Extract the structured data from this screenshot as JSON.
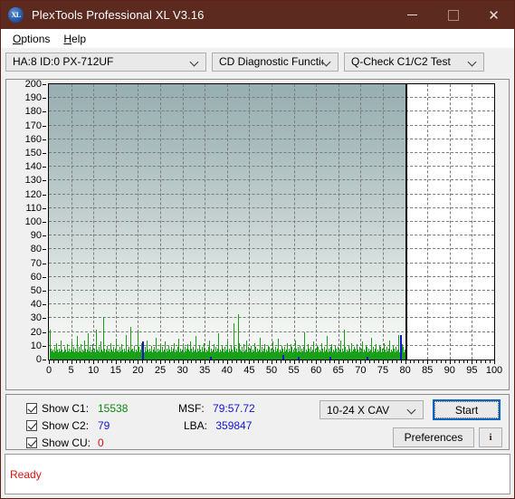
{
  "window": {
    "title": "PlexTools Professional XL V3.16",
    "logo_text": "XL",
    "minimize_label": "Minimize",
    "maximize_label": "Maximize",
    "close_label": "Close"
  },
  "menu": {
    "items": [
      {
        "label": "Options",
        "accel": "O"
      },
      {
        "label": "Help",
        "accel": "H"
      }
    ]
  },
  "toolbar": {
    "drive_combo": "HA:8 ID:0  PX-712UF",
    "function_combo": "CD Diagnostic Functions",
    "test_combo": "Q-Check C1/C2 Test"
  },
  "controls": {
    "show_c1_label": "Show C1:",
    "show_c2_label": "Show C2:",
    "show_cu_label": "Show CU:",
    "show_c1_checked": true,
    "show_c2_checked": true,
    "show_cu_checked": true,
    "c1_value": "15538",
    "c2_value": "79",
    "cu_value": "0",
    "msf_label": "MSF:",
    "msf_value": "79:57.72",
    "lba_label": "LBA:",
    "lba_value": "359847",
    "speed_combo": "10-24 X CAV",
    "start_label": "Start",
    "preferences_label": "Preferences",
    "info_label": "i"
  },
  "status": {
    "text": "Ready"
  },
  "colors": {
    "titlebar": "#5c2a1e",
    "c1": "#19a019",
    "c2": "#1414d2",
    "cu": "#d01010",
    "accent": "#0a64c8",
    "status_text": "#e01010"
  },
  "chart_data": {
    "type": "bar",
    "title": "",
    "xlabel": "",
    "ylabel": "",
    "xlim": [
      0,
      100
    ],
    "ylim": [
      0,
      200
    ],
    "ytick_step": 10,
    "xtick_step": 5,
    "yticks": [
      0,
      10,
      20,
      30,
      40,
      50,
      60,
      70,
      80,
      90,
      100,
      110,
      120,
      130,
      140,
      150,
      160,
      170,
      180,
      190,
      200
    ],
    "xticks": [
      0,
      5,
      10,
      15,
      20,
      25,
      30,
      35,
      40,
      45,
      50,
      55,
      60,
      65,
      70,
      75,
      80,
      85,
      90,
      95,
      100
    ],
    "grid": true,
    "data_end_x": 80,
    "marker_line_x": 80,
    "legend": [
      "C1",
      "C2",
      "CU"
    ],
    "series": [
      {
        "name": "C1",
        "color": "#19a019",
        "x": [
          0.2,
          0.4,
          0.6,
          0.8,
          1.0,
          1.2,
          1.4,
          1.6,
          1.8,
          2.0,
          2.2,
          2.4,
          2.6,
          2.8,
          3.0,
          3.2,
          3.4,
          3.6,
          3.8,
          4.0,
          4.2,
          4.4,
          4.6,
          4.8,
          5.0,
          5.2,
          5.4,
          5.6,
          5.8,
          6.0,
          6.2,
          6.4,
          6.6,
          6.8,
          7.0,
          7.2,
          7.4,
          7.6,
          7.8,
          8.0,
          8.2,
          8.4,
          8.6,
          8.8,
          9.0,
          9.2,
          9.4,
          9.6,
          9.8,
          10.0,
          10.2,
          10.4,
          10.6,
          10.8,
          11.0,
          11.2,
          11.4,
          11.6,
          11.8,
          12.0,
          12.2,
          12.4,
          12.6,
          12.8,
          13.0,
          13.2,
          13.4,
          13.6,
          13.8,
          14.0,
          14.2,
          14.4,
          14.6,
          14.8,
          15.0,
          15.2,
          15.4,
          15.6,
          15.8,
          16.0,
          16.2,
          16.4,
          16.6,
          16.8,
          17.0,
          17.2,
          17.4,
          17.6,
          17.8,
          18.0,
          18.2,
          18.4,
          18.6,
          18.8,
          19.0,
          19.2,
          19.4,
          19.6,
          19.8,
          20.0,
          20.2,
          20.4,
          20.6,
          20.8,
          21.0,
          21.2,
          21.4,
          21.6,
          21.8,
          22.0,
          22.2,
          22.4,
          22.6,
          22.8,
          23.0,
          23.2,
          23.4,
          23.6,
          23.8,
          24.0,
          24.2,
          24.4,
          24.6,
          24.8,
          25.0,
          25.2,
          25.4,
          25.6,
          25.8,
          26.0,
          26.2,
          26.4,
          26.6,
          26.8,
          27.0,
          27.2,
          27.4,
          27.6,
          27.8,
          28.0,
          28.2,
          28.4,
          28.6,
          28.8,
          29.0,
          29.2,
          29.4,
          29.6,
          29.8,
          30.0,
          30.2,
          30.4,
          30.6,
          30.8,
          31.0,
          31.2,
          31.4,
          31.6,
          31.8,
          32.0,
          32.2,
          32.4,
          32.6,
          32.8,
          33.0,
          33.2,
          33.4,
          33.6,
          33.8,
          34.0,
          34.2,
          34.4,
          34.6,
          34.8,
          35.0,
          35.2,
          35.4,
          35.6,
          35.8,
          36.0,
          36.2,
          36.4,
          36.6,
          36.8,
          37.0,
          37.2,
          37.4,
          37.6,
          37.8,
          38.0,
          38.2,
          38.4,
          38.6,
          38.8,
          39.0,
          39.2,
          39.4,
          39.6,
          39.8,
          40.0,
          40.2,
          40.4,
          40.6,
          40.8,
          41.0,
          41.2,
          41.4,
          41.6,
          41.8,
          42.0,
          42.2,
          42.4,
          42.6,
          42.8,
          43.0,
          43.2,
          43.4,
          43.6,
          43.8,
          44.0,
          44.2,
          44.4,
          44.6,
          44.8,
          45.0,
          45.2,
          45.4,
          45.6,
          45.8,
          46.0,
          46.2,
          46.4,
          46.6,
          46.8,
          47.0,
          47.2,
          47.4,
          47.6,
          47.8,
          48.0,
          48.2,
          48.4,
          48.6,
          48.8,
          49.0,
          49.2,
          49.4,
          49.6,
          49.8,
          50.0,
          50.2,
          50.4,
          50.6,
          50.8,
          51.0,
          51.2,
          51.4,
          51.6,
          51.8,
          52.0,
          52.2,
          52.4,
          52.6,
          52.8,
          53.0,
          53.2,
          53.4,
          53.6,
          53.8,
          54.0,
          54.2,
          54.4,
          54.6,
          54.8,
          55.0,
          55.2,
          55.4,
          55.6,
          55.8,
          56.0,
          56.2,
          56.4,
          56.6,
          56.8,
          57.0,
          57.2,
          57.4,
          57.6,
          57.8,
          58.0,
          58.2,
          58.4,
          58.6,
          58.8,
          59.0,
          59.2,
          59.4,
          59.6,
          59.8,
          60.0,
          60.2,
          60.4,
          60.6,
          60.8,
          61.0,
          61.2,
          61.4,
          61.6,
          61.8,
          62.0,
          62.2,
          62.4,
          62.6,
          62.8,
          63.0,
          63.2,
          63.4,
          63.6,
          63.8,
          64.0,
          64.2,
          64.4,
          64.6,
          64.8,
          65.0,
          65.2,
          65.4,
          65.6,
          65.8,
          66.0,
          66.2,
          66.4,
          66.6,
          66.8,
          67.0,
          67.2,
          67.4,
          67.6,
          67.8,
          68.0,
          68.2,
          68.4,
          68.6,
          68.8,
          69.0,
          69.2,
          69.4,
          69.6,
          69.8,
          70.0,
          70.2,
          70.4,
          70.6,
          70.8,
          71.0,
          71.2,
          71.4,
          71.6,
          71.8,
          72.0,
          72.2,
          72.4,
          72.6,
          72.8,
          73.0,
          73.2,
          73.4,
          73.6,
          73.8,
          74.0,
          74.2,
          74.4,
          74.6,
          74.8,
          75.0,
          75.2,
          75.4,
          75.6,
          75.8,
          76.0,
          76.2,
          76.4,
          76.6,
          76.8,
          77.0,
          77.2,
          77.4,
          77.6,
          77.8,
          78.0,
          78.2,
          78.4,
          78.6,
          78.8,
          79.0,
          79.2,
          79.4,
          79.6,
          79.8
        ],
        "values": [
          22,
          8,
          6,
          7,
          5,
          9,
          6,
          12,
          7,
          5,
          8,
          6,
          14,
          7,
          5,
          6,
          9,
          7,
          5,
          11,
          6,
          8,
          5,
          7,
          13,
          6,
          9,
          5,
          8,
          6,
          17,
          7,
          5,
          9,
          6,
          11,
          5,
          7,
          6,
          14,
          8,
          5,
          7,
          19,
          6,
          9,
          5,
          7,
          11,
          6,
          8,
          5,
          22,
          7,
          6,
          9,
          5,
          13,
          7,
          6,
          31,
          8,
          5,
          7,
          10,
          6,
          8,
          5,
          12,
          7,
          6,
          9,
          5,
          8,
          15,
          6,
          7,
          5,
          9,
          6,
          11,
          7,
          5,
          8,
          6,
          18,
          5,
          7,
          9,
          6,
          24,
          7,
          5,
          8,
          6,
          10,
          5,
          7,
          6,
          21,
          9,
          5,
          7,
          12,
          6,
          8,
          5,
          9,
          6,
          14,
          7,
          5,
          8,
          6,
          10,
          5,
          7,
          9,
          6,
          16,
          5,
          8,
          6,
          7,
          11,
          5,
          9,
          6,
          7,
          13,
          5,
          8,
          6,
          10,
          7,
          5,
          9,
          6,
          8,
          12,
          5,
          7,
          6,
          9,
          15,
          5,
          8,
          6,
          7,
          10,
          5,
          9,
          6,
          8,
          11,
          5,
          7,
          6,
          13,
          8,
          5,
          9,
          6,
          7,
          17,
          5,
          8,
          6,
          10,
          7,
          5,
          9,
          6,
          12,
          8,
          5,
          7,
          6,
          9,
          14,
          5,
          8,
          6,
          7,
          11,
          5,
          9,
          6,
          8,
          19,
          5,
          7,
          6,
          10,
          8,
          5,
          9,
          6,
          7,
          13,
          5,
          8,
          6,
          10,
          7,
          5,
          26,
          9,
          6,
          8,
          5,
          33,
          12,
          7,
          6,
          9,
          5,
          11,
          8,
          6,
          7,
          14,
          5,
          9,
          6,
          8,
          10,
          5,
          7,
          6,
          12,
          9,
          5,
          8,
          6,
          7,
          16,
          5,
          9,
          6,
          8,
          11,
          5,
          7,
          6,
          10,
          9,
          5,
          8,
          6,
          13,
          7,
          5,
          9,
          6,
          8,
          15,
          5,
          7,
          6,
          10,
          8,
          5,
          9,
          6,
          7,
          12,
          5,
          8,
          6,
          11,
          9,
          5,
          7,
          6,
          14,
          8,
          5,
          9,
          6,
          7,
          10,
          5,
          8,
          6,
          9,
          20,
          5,
          7,
          6,
          11,
          8,
          5,
          9,
          6,
          7,
          13,
          5,
          8,
          6,
          10,
          9,
          5,
          7,
          6,
          12,
          8,
          5,
          9,
          6,
          7,
          17,
          5,
          8,
          6,
          9,
          11,
          5,
          7,
          6,
          10,
          8,
          5,
          9,
          6,
          7,
          14,
          5,
          8,
          6,
          22,
          9,
          5,
          7,
          6,
          10,
          8,
          5,
          12,
          6,
          7,
          9,
          5,
          8,
          6,
          11,
          7,
          5,
          9,
          6,
          8,
          13,
          5,
          7,
          6,
          10,
          9,
          5,
          8,
          6,
          7,
          16,
          5,
          9,
          6,
          8,
          11,
          5,
          7,
          6,
          10,
          9,
          5,
          8,
          6,
          12,
          7,
          5,
          9,
          6,
          8,
          14,
          5,
          7,
          6,
          10,
          8,
          5,
          9,
          6,
          7,
          18,
          5,
          8,
          6,
          11,
          9,
          5,
          7,
          6,
          10,
          8,
          5,
          9,
          6,
          7,
          12,
          5,
          8,
          6,
          9,
          11,
          5,
          7,
          6,
          10,
          8,
          5,
          9,
          6,
          7,
          13,
          5,
          8,
          6,
          10,
          9,
          5,
          7,
          6,
          15,
          8,
          5,
          9,
          6,
          7,
          11,
          5,
          8,
          6,
          9,
          10,
          5,
          7,
          6,
          12,
          8,
          5,
          9,
          6,
          7,
          14,
          5,
          8,
          6,
          10,
          9,
          5,
          7,
          6,
          11,
          8,
          5,
          9,
          6,
          7,
          10,
          5,
          8,
          6,
          9,
          12,
          5,
          7,
          6,
          10,
          8,
          5,
          9,
          6,
          7,
          11
        ]
      },
      {
        "name": "C2",
        "color": "#1414d2",
        "x": [
          20.9,
          36.2,
          52.4,
          55.8,
          63.1,
          71.4,
          78.9
        ],
        "values": [
          13,
          2,
          3,
          2,
          2,
          2,
          18
        ]
      },
      {
        "name": "CU",
        "color": "#d01010",
        "x": [],
        "values": []
      }
    ]
  }
}
